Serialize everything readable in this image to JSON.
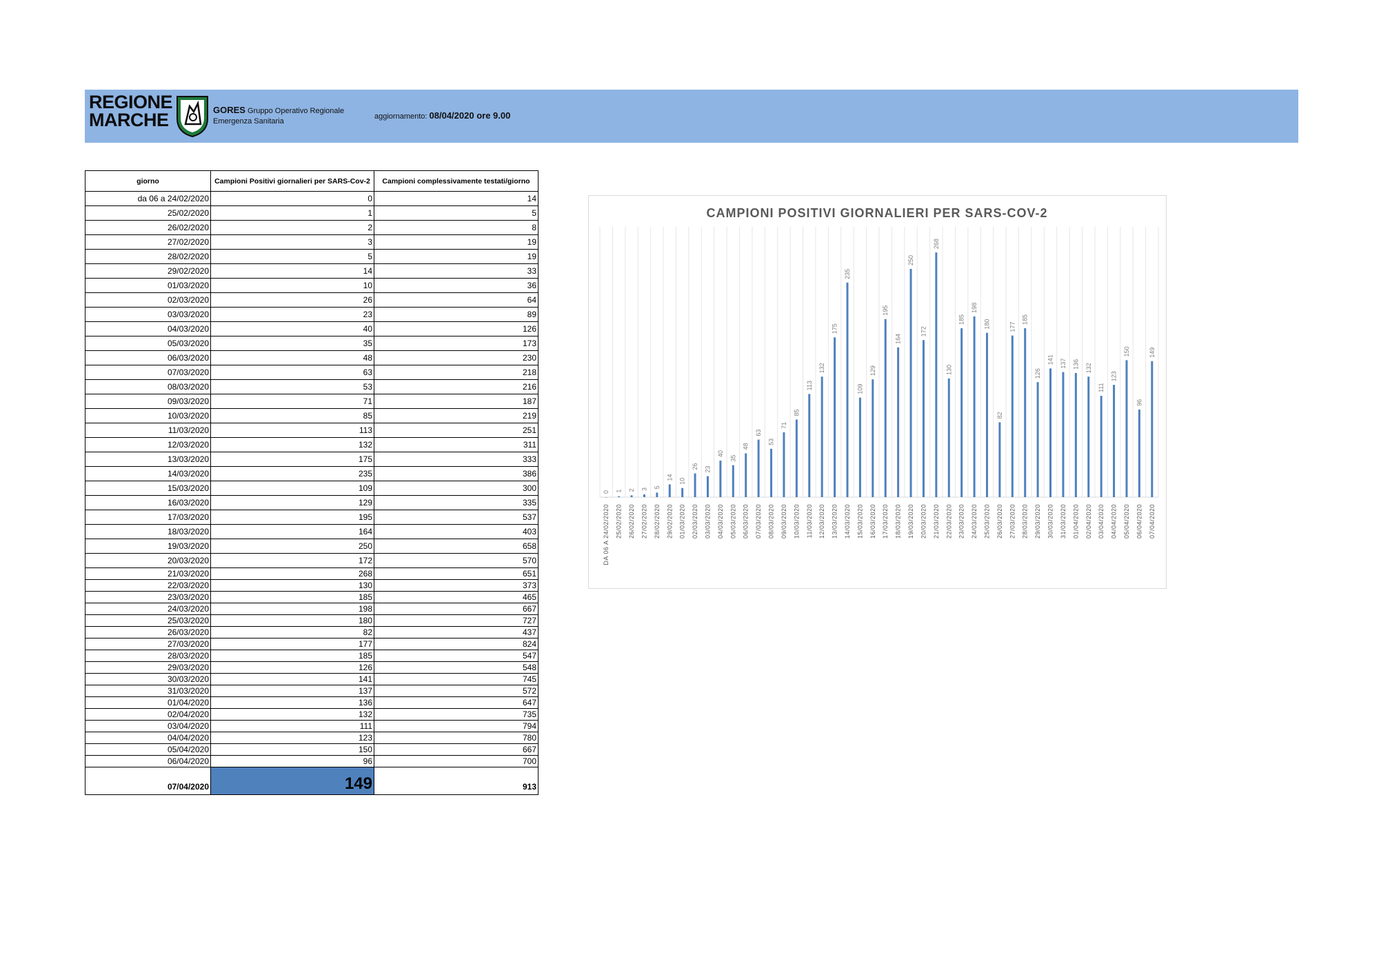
{
  "header": {
    "logo_line1": "REGIONE",
    "logo_line2": "MARCHE",
    "org_name": "GORES",
    "org_sub1": "Gruppo Operativo Regionale",
    "org_sub2": "Emergenza Sanitaria",
    "update_label": "aggiornamento:",
    "update_value": "08/04/2020 ore 9.00"
  },
  "table": {
    "columns": [
      "giorno",
      "Campioni Positivi giornalieri per SARS-Cov-2",
      "Campioni complessivamente testati/giorno"
    ],
    "rows": [
      [
        "da 06 a 24/02/2020",
        "0",
        "14"
      ],
      [
        "25/02/2020",
        "1",
        "5"
      ],
      [
        "26/02/2020",
        "2",
        "8"
      ],
      [
        "27/02/2020",
        "3",
        "19"
      ],
      [
        "28/02/2020",
        "5",
        "19"
      ],
      [
        "29/02/2020",
        "14",
        "33"
      ],
      [
        "01/03/2020",
        "10",
        "36"
      ],
      [
        "02/03/2020",
        "26",
        "64"
      ],
      [
        "03/03/2020",
        "23",
        "89"
      ],
      [
        "04/03/2020",
        "40",
        "126"
      ],
      [
        "05/03/2020",
        "35",
        "173"
      ],
      [
        "06/03/2020",
        "48",
        "230"
      ],
      [
        "07/03/2020",
        "63",
        "218"
      ],
      [
        "08/03/2020",
        "53",
        "216"
      ],
      [
        "09/03/2020",
        "71",
        "187"
      ],
      [
        "10/03/2020",
        "85",
        "219"
      ],
      [
        "11/03/2020",
        "113",
        "251"
      ],
      [
        "12/03/2020",
        "132",
        "311"
      ],
      [
        "13/03/2020",
        "175",
        "333"
      ],
      [
        "14/03/2020",
        "235",
        "386"
      ],
      [
        "15/03/2020",
        "109",
        "300"
      ],
      [
        "16/03/2020",
        "129",
        "335"
      ],
      [
        "17/03/2020",
        "195",
        "537"
      ],
      [
        "18/03/2020",
        "164",
        "403"
      ],
      [
        "19/03/2020",
        "250",
        "658"
      ],
      [
        "20/03/2020",
        "172",
        "570"
      ],
      [
        "21/03/2020",
        "268",
        "651"
      ],
      [
        "22/03/2020",
        "130",
        "373"
      ],
      [
        "23/03/2020",
        "185",
        "465"
      ],
      [
        "24/03/2020",
        "198",
        "667"
      ],
      [
        "25/03/2020",
        "180",
        "727"
      ],
      [
        "26/03/2020",
        "82",
        "437"
      ],
      [
        "27/03/2020",
        "177",
        "824"
      ],
      [
        "28/03/2020",
        "185",
        "547"
      ],
      [
        "29/03/2020",
        "126",
        "548"
      ],
      [
        "30/03/2020",
        "141",
        "745"
      ],
      [
        "31/03/2020",
        "137",
        "572"
      ],
      [
        "01/04/2020",
        "136",
        "647"
      ],
      [
        "02/04/2020",
        "132",
        "735"
      ],
      [
        "03/04/2020",
        "111",
        "794"
      ],
      [
        "04/04/2020",
        "123",
        "780"
      ],
      [
        "05/04/2020",
        "150",
        "667"
      ],
      [
        "06/04/2020",
        "96",
        "700"
      ],
      [
        "07/04/2020",
        "149",
        "913"
      ]
    ]
  },
  "chart_data": {
    "type": "bar",
    "title": "CAMPIONI POSITIVI GIORNALIERI PER SARS-COV-2",
    "xlabel": "",
    "ylabel": "",
    "grid": true,
    "ylim": [
      0,
      290
    ],
    "bar_color": "#4f81bd",
    "categories": [
      "DA 06 A 24/02/2020",
      "25/02/2020",
      "26/02/2020",
      "27/02/2020",
      "28/02/2020",
      "29/02/2020",
      "01/03/2020",
      "02/03/2020",
      "03/03/2020",
      "04/03/2020",
      "05/03/2020",
      "06/03/2020",
      "07/03/2020",
      "08/03/2020",
      "09/03/2020",
      "10/03/2020",
      "11/03/2020",
      "12/03/2020",
      "13/03/2020",
      "14/03/2020",
      "15/03/2020",
      "16/03/2020",
      "17/03/2020",
      "18/03/2020",
      "19/03/2020",
      "20/03/2020",
      "21/03/2020",
      "22/03/2020",
      "23/03/2020",
      "24/03/2020",
      "25/03/2020",
      "26/03/2020",
      "27/03/2020",
      "28/03/2020",
      "29/03/2020",
      "30/03/2020",
      "31/03/2020",
      "01/04/2020",
      "02/04/2020",
      "03/04/2020",
      "04/04/2020",
      "05/04/2020",
      "06/04/2020",
      "07/04/2020"
    ],
    "values": [
      0,
      1,
      2,
      3,
      5,
      14,
      10,
      26,
      23,
      40,
      35,
      48,
      63,
      53,
      71,
      85,
      113,
      132,
      175,
      235,
      109,
      129,
      195,
      164,
      250,
      172,
      268,
      130,
      185,
      198,
      180,
      82,
      177,
      185,
      126,
      141,
      137,
      136,
      132,
      111,
      123,
      150,
      96,
      149
    ]
  }
}
